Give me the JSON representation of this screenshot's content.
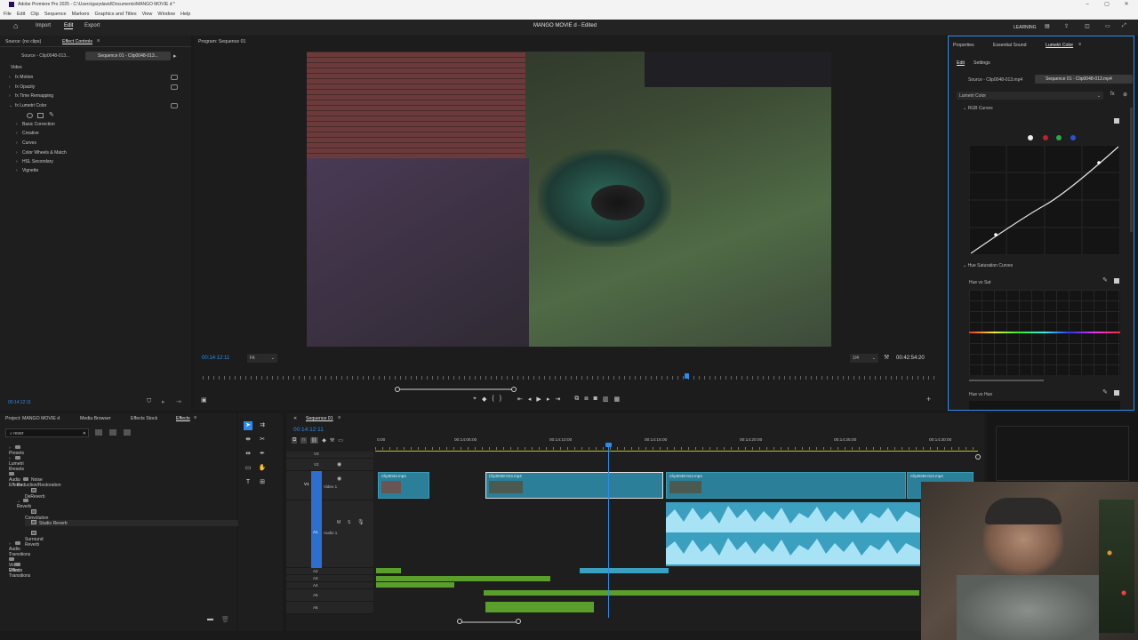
{
  "window": {
    "title": "Adobe Premiere Pro 2025 - C:\\Users\\garydavid\\Documents\\MANGO MOVIE d *"
  },
  "menu": [
    "File",
    "Edit",
    "Clip",
    "Sequence",
    "Markers",
    "Graphics and Titles",
    "View",
    "Window",
    "Help"
  ],
  "header": {
    "tabs": [
      "Import",
      "Edit",
      "Export"
    ],
    "project_title": "MANGO MOVIE d - Edited",
    "workspace": "LEARNING"
  },
  "source_panel": {
    "tab_source": "Source: (no clips)",
    "tab_effect_controls": "Effect Controls",
    "source_clip": "Source - Clip0048-013...",
    "seq_clip": "Sequence 01 - Clip0048-013...",
    "section": "Video",
    "effects": [
      "Motion",
      "Opacity",
      "Time Remapping",
      "Lumetri Color"
    ],
    "lumetri_items": [
      "Basic Correction",
      "Creative",
      "Curves",
      "Color Wheels & Match",
      "HSL Secondary",
      "Vignette"
    ],
    "timecode": "00:14:12:11"
  },
  "program": {
    "title": "Program: Sequence 01",
    "timecode": "00:14:12:11",
    "fit": "Fit",
    "resolution": "1/4",
    "duration": "00:42:54:20"
  },
  "lumetri": {
    "tabs": [
      "Properties",
      "Essential Sound",
      "Lumetri Color"
    ],
    "subtabs": [
      "Edit",
      "Settings"
    ],
    "source_clip": "Source - Clip0048-013.mp4",
    "seq_clip": "Sequence 01 - Clip0048-013.mp4",
    "effect": "Lumetri Color",
    "rgb_curves": "RGB Curves",
    "hue_sat_curves": "Hue Saturation Curves",
    "hue_vs_sat": "Hue vs Sat",
    "hue_vs_hue": "Hue vs Hue"
  },
  "project_panel": {
    "tabs": [
      "Project: MANGO MOVIE d",
      "Media Browser",
      "Effects Stock",
      "Effects"
    ],
    "search_value": "rever",
    "tree": [
      {
        "label": "Presets",
        "level": 0,
        "type": "folder"
      },
      {
        "label": "Lumetri Presets",
        "level": 0,
        "type": "folder"
      },
      {
        "label": "Audio Effects",
        "level": 0,
        "type": "folder"
      },
      {
        "label": "Noise Reduction/Restoration",
        "level": 1,
        "type": "folder"
      },
      {
        "label": "DeReverb",
        "level": 2,
        "type": "fx"
      },
      {
        "label": "Reverb",
        "level": 1,
        "type": "folder"
      },
      {
        "label": "Convolution Reverb",
        "level": 2,
        "type": "fx"
      },
      {
        "label": "Studio Reverb",
        "level": 2,
        "type": "fx"
      },
      {
        "label": "Surround Reverb",
        "level": 2,
        "type": "fx"
      },
      {
        "label": "Audio Transitions",
        "level": 0,
        "type": "folder"
      },
      {
        "label": "Video Effects",
        "level": 0,
        "type": "folder"
      },
      {
        "label": "Video Transitions",
        "level": 0,
        "type": "folder"
      }
    ]
  },
  "timeline": {
    "tab": "Sequence 01",
    "timecode": "00:14:12:11",
    "ruler": [
      "0:00",
      "00:14:05:00",
      "00:14:10:00",
      "00:14:15:00",
      "00:14:20:00",
      "00:14:25:00",
      "00:14:30:00"
    ],
    "tracks": {
      "v3": "V3",
      "v2": "V2",
      "v1": "V1",
      "video1": "Video 1",
      "a1": "A1",
      "audio1": "Audio 1",
      "a2": "A2",
      "a3": "A3",
      "a4": "A4",
      "a5": "A5",
      "a6": "A6"
    },
    "clips": [
      "Clip0044.mp4",
      "Clip0048-013.mp4",
      "Clip0048-013.mp4",
      "Clip0048-013.mp4"
    ]
  },
  "colors": {
    "accent": "#2d8ceb",
    "clip": "#2b7f98",
    "audio": "#3b9fc0",
    "green": "#5a9e2c"
  }
}
